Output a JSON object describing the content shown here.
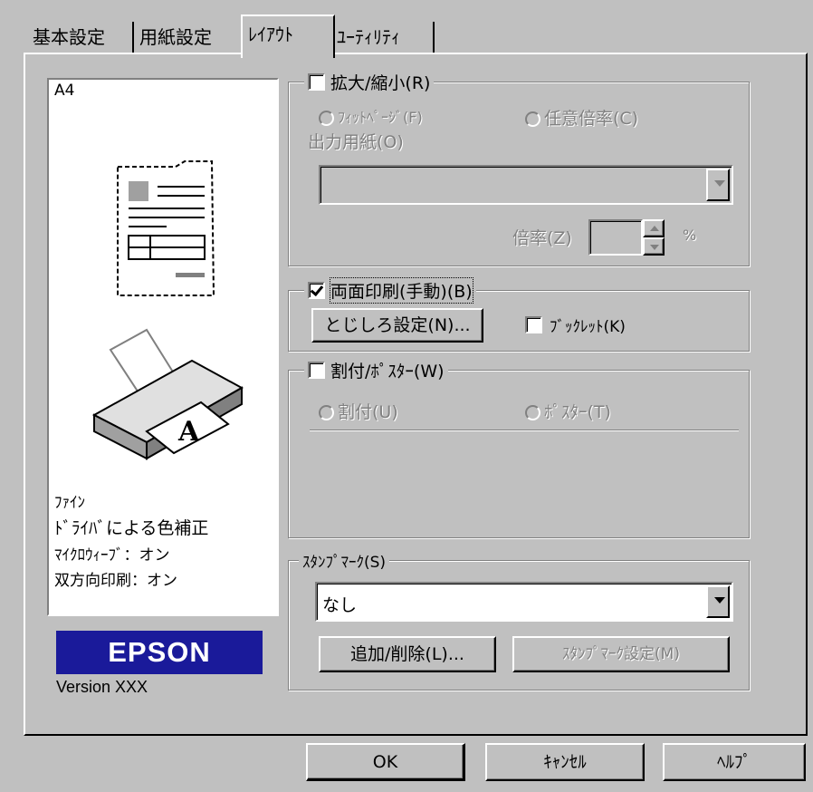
{
  "tabs": [
    {
      "label": "基本設定"
    },
    {
      "label": "用紙設定"
    },
    {
      "label": "ﾚｲｱｳﾄ"
    },
    {
      "label": "ﾕｰﾃｨﾘﾃｨ"
    }
  ],
  "preview": {
    "paper_size": "A4",
    "quality": "ﾌｧｲﾝ",
    "color_correction": "ﾄﾞﾗｲﾊﾞによる色補正",
    "microweave": "ﾏｲｸﾛｳｨｰﾌﾞ：オン",
    "bidirectional": "双方向印刷：オン"
  },
  "brand": {
    "logo": "EPSON",
    "version": "Version XXX",
    "logo_color": "#1a1a9a"
  },
  "scale": {
    "title": "拡大/縮小(R)",
    "checked": false,
    "fit_page": "ﾌｨｯﾄﾍﾟｰｼﾞ(F)",
    "custom_ratio": "任意倍率(C)",
    "output_paper_label": "出力用紙(O)",
    "output_paper_value": "",
    "ratio_label": "倍率(Z)",
    "ratio_value": "",
    "percent": "%"
  },
  "duplex": {
    "title": "両面印刷(手動)(B)",
    "checked": true,
    "binding_button": "とじしろ設定(N)...",
    "booklet": "ﾌﾞｯｸﾚｯﾄ(K)",
    "booklet_checked": false
  },
  "multipage": {
    "title": "割付/ﾎﾟｽﾀｰ(W)",
    "checked": false,
    "nup": "割付(U)",
    "poster": "ﾎﾟｽﾀｰ(T)"
  },
  "stamp": {
    "title": "ｽﾀﾝﾌﾟﾏｰｸ(S)",
    "selected": "なし",
    "add_delete_button": "追加/削除(L)...",
    "settings_button": "ｽﾀﾝﾌﾟﾏｰｸ設定(M)"
  },
  "footer": {
    "ok": "OK",
    "cancel": "ｷｬﾝｾﾙ",
    "help": "ﾍﾙﾌﾟ"
  }
}
